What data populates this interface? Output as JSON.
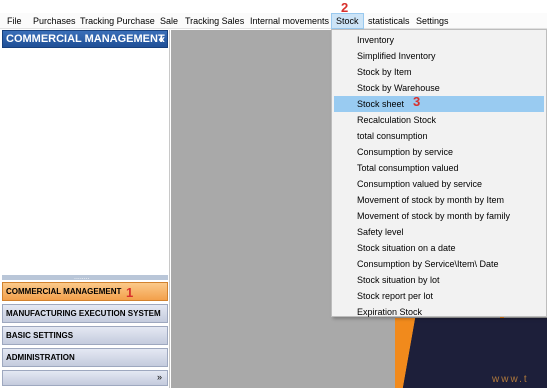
{
  "menubar": {
    "items": [
      "File",
      "Purchases",
      "Tracking Purchase",
      "Sale",
      "Tracking Sales",
      "Internal movements",
      "Stock",
      "statisticals",
      "Settings"
    ],
    "active": "Stock"
  },
  "steps": {
    "menu": "2",
    "submenu": "3",
    "nav": "1"
  },
  "sidebar": {
    "header": "COMMERCIAL MANAGEMENT",
    "collapse_glyph": "«",
    "splitter_dots": "........",
    "buttons": [
      "COMMERCIAL MANAGEMENT",
      "MANUFACTURING EXECUTION SYSTEM",
      "BASIC SETTINGS",
      "ADMINISTRATION"
    ],
    "selected": "COMMERCIAL MANAGEMENT",
    "footer_glyph": "»"
  },
  "stock_menu": {
    "items": [
      "Inventory",
      "Simplified Inventory",
      "Stock by Item",
      "Stock by Warehouse",
      "Stock sheet",
      "Recalculation Stock",
      "total consumption",
      "Consumption by service",
      "Total consumption valued",
      "Consumption valued by service",
      "Movement of stock by month by Item",
      "Movement of stock by month by family",
      "Safety level",
      "Stock situation on a date",
      "Consumption by Service\\Item\\ Date",
      "Stock situation by lot",
      "Stock report per lot",
      "Expiration Stock"
    ],
    "highlighted": "Stock sheet"
  },
  "background": {
    "text": "www.t"
  },
  "colors": {
    "step_marker": "#d8302c",
    "menu_highlight": "#99cbf1",
    "nav_selected": "#f3a04b",
    "header_blue": "#1f4f97"
  }
}
